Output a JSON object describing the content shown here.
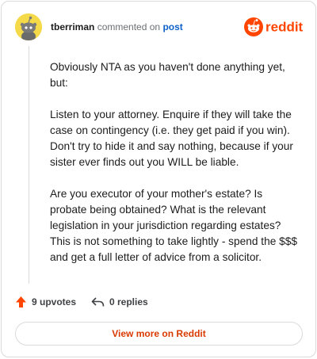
{
  "comment": {
    "author": "tberriman",
    "action_text": "commented on",
    "post_link": "post",
    "paragraphs": [
      "Obviously NTA as you haven't done anything yet, but:",
      "Listen to your attorney. Enquire if they will take the case on contingency (i.e. they get paid if you win). Don't try to hide it and say nothing, because if your sister ever finds out you WILL be liable.",
      "Are you executor of your mother's estate? Is probate being obtained? What is the relevant legislation in your jurisdiction regarding estates? This is not something to take lightly - spend the $$$ and get a full letter of advice from a solicitor."
    ]
  },
  "brand": {
    "name": "reddit",
    "color": "#ff4500"
  },
  "actions": {
    "upvotes_label": "9 upvotes",
    "replies_label": "0 replies",
    "upvote_icon": "upvote-arrow-icon",
    "reply_icon": "reply-arrow-icon"
  },
  "footer": {
    "view_more_label": "View more on Reddit"
  },
  "colors": {
    "accent": "#d93a00",
    "link": "#0d60c8",
    "upvote": "#ff4500"
  }
}
